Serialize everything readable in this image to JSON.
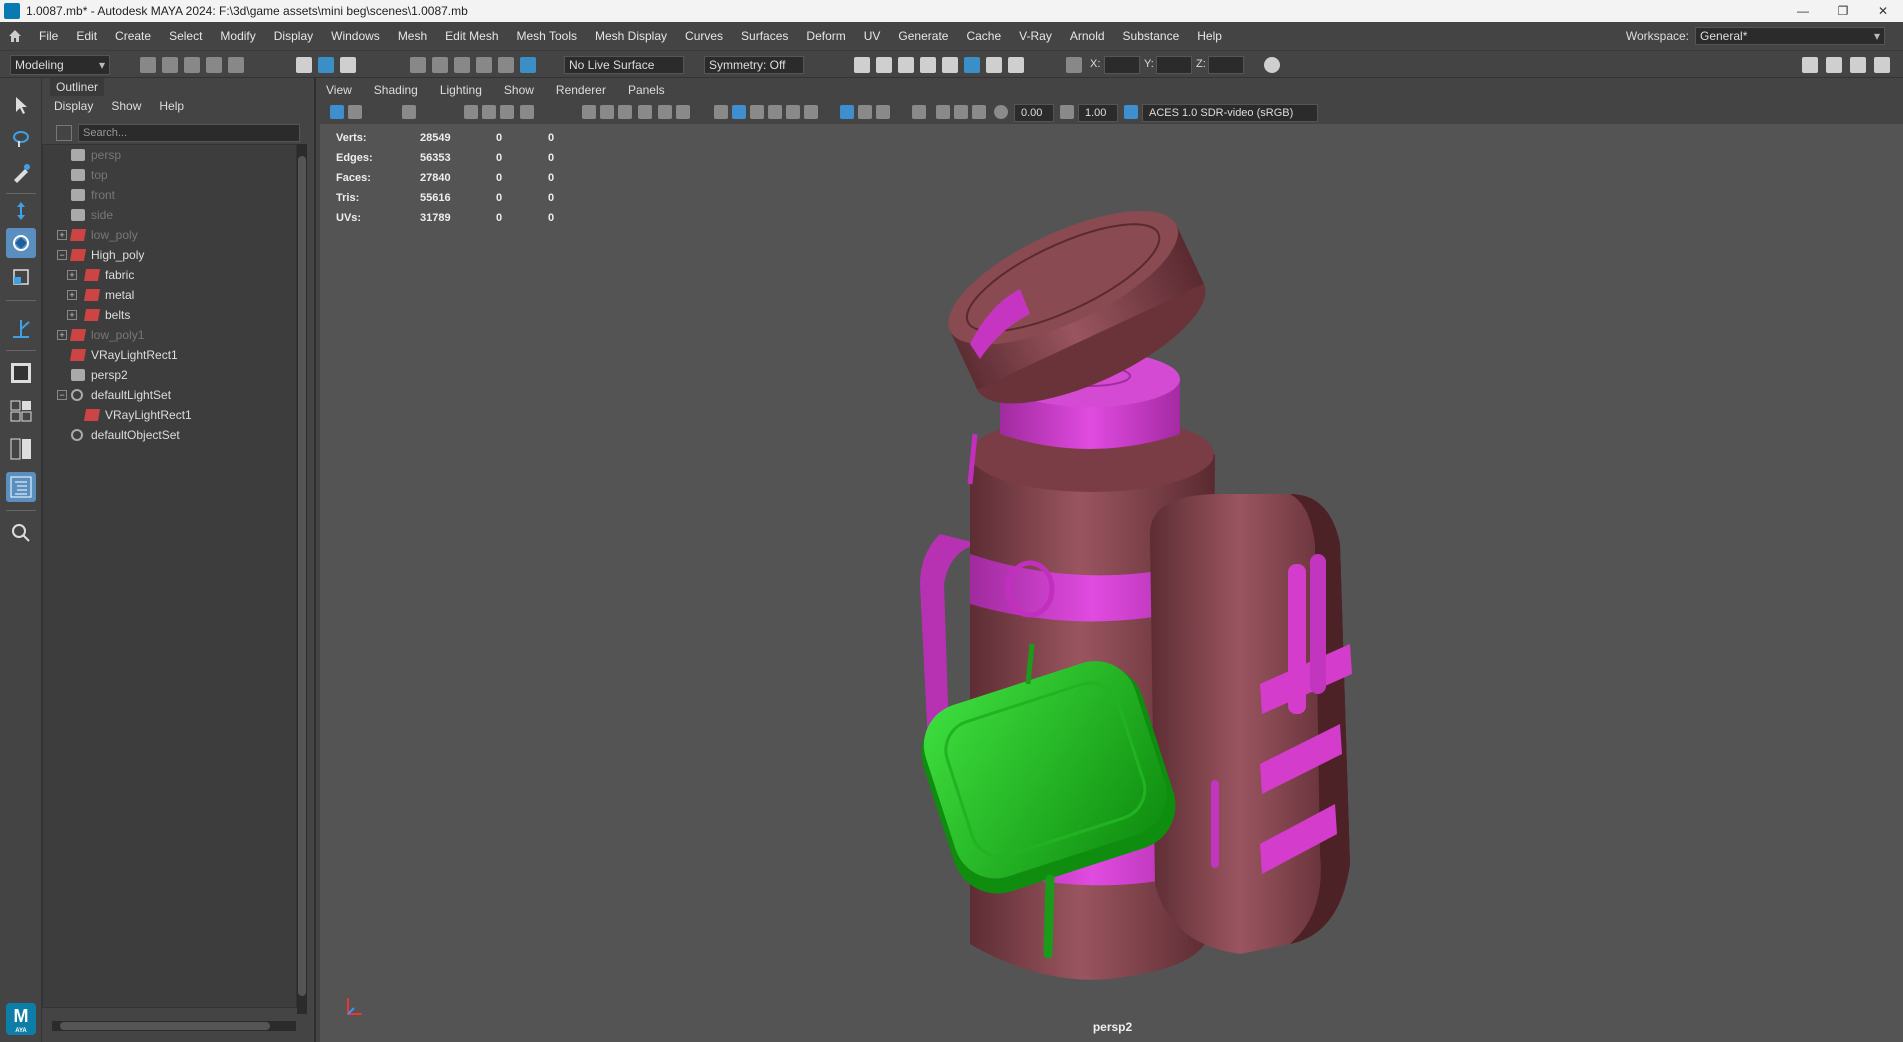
{
  "titlebar": {
    "title": "1.0087.mb* - Autodesk MAYA 2024: F:\\3d\\game assets\\mini beg\\scenes\\1.0087.mb",
    "controls": [
      "—",
      "❐",
      "✕"
    ]
  },
  "menubar": {
    "items": [
      "File",
      "Edit",
      "Create",
      "Select",
      "Modify",
      "Display",
      "Windows",
      "Mesh",
      "Edit Mesh",
      "Mesh Tools",
      "Mesh Display",
      "Curves",
      "Surfaces",
      "Deform",
      "UV",
      "Generate",
      "Cache",
      "V-Ray",
      "Arnold",
      "Substance",
      "Help"
    ],
    "workspace_label": "Workspace:",
    "workspace_value": "General*"
  },
  "statusline": {
    "mode": "Modeling",
    "live_surface": "No Live Surface",
    "symmetry": "Symmetry: Off",
    "x_label": "X:",
    "y_label": "Y:",
    "z_label": "Z:"
  },
  "outliner": {
    "tab": "Outliner",
    "menu": [
      "Display",
      "Show",
      "Help"
    ],
    "search_placeholder": "Search...",
    "rows": [
      {
        "label": "persp",
        "kind": "camera",
        "indent": 0,
        "dim": true,
        "expander": ""
      },
      {
        "label": "top",
        "kind": "camera",
        "indent": 0,
        "dim": true,
        "expander": ""
      },
      {
        "label": "front",
        "kind": "camera",
        "indent": 0,
        "dim": true,
        "expander": ""
      },
      {
        "label": "side",
        "kind": "camera",
        "indent": 0,
        "dim": true,
        "expander": ""
      },
      {
        "label": "low_poly",
        "kind": "transform",
        "indent": 0,
        "dim": true,
        "expander": "+"
      },
      {
        "label": "High_poly",
        "kind": "transform",
        "indent": 0,
        "dim": false,
        "expander": "−"
      },
      {
        "label": "fabric",
        "kind": "transform",
        "indent": 1,
        "dim": false,
        "expander": "+"
      },
      {
        "label": "metal",
        "kind": "transform",
        "indent": 1,
        "dim": false,
        "expander": "+"
      },
      {
        "label": "belts",
        "kind": "transform",
        "indent": 1,
        "dim": false,
        "expander": "+"
      },
      {
        "label": "low_poly1",
        "kind": "transform",
        "indent": 0,
        "dim": true,
        "expander": "+"
      },
      {
        "label": "VRayLightRect1",
        "kind": "transform",
        "indent": 0,
        "dim": false,
        "expander": ""
      },
      {
        "label": "persp2",
        "kind": "camera",
        "indent": 0,
        "dim": false,
        "expander": ""
      },
      {
        "label": "defaultLightSet",
        "kind": "set",
        "indent": 0,
        "dim": false,
        "expander": "−"
      },
      {
        "label": "VRayLightRect1",
        "kind": "transform",
        "indent": 1,
        "dim": false,
        "expander": ""
      },
      {
        "label": "defaultObjectSet",
        "kind": "set",
        "indent": 0,
        "dim": false,
        "expander": ""
      }
    ]
  },
  "panel": {
    "menu": [
      "View",
      "Shading",
      "Lighting",
      "Show",
      "Renderer",
      "Panels"
    ],
    "exposure": "0.00",
    "gamma": "1.00",
    "colorspace": "ACES 1.0 SDR-video (sRGB)"
  },
  "hud": {
    "rows": [
      {
        "label": "Verts:",
        "v1": "28549",
        "v2": "0",
        "v3": "0"
      },
      {
        "label": "Edges:",
        "v1": "56353",
        "v2": "0",
        "v3": "0"
      },
      {
        "label": "Faces:",
        "v1": "27840",
        "v2": "0",
        "v3": "0"
      },
      {
        "label": "Tris:",
        "v1": "55616",
        "v2": "0",
        "v3": "0"
      },
      {
        "label": "UVs:",
        "v1": "31789",
        "v2": "0",
        "v3": "0"
      }
    ]
  },
  "viewport": {
    "camera": "persp2"
  },
  "logo": {
    "letter": "M",
    "sub": "AYA"
  },
  "colors": {
    "body": "#8a4a52",
    "belt": "#d43ccc",
    "pouch": "#1ec41e"
  }
}
